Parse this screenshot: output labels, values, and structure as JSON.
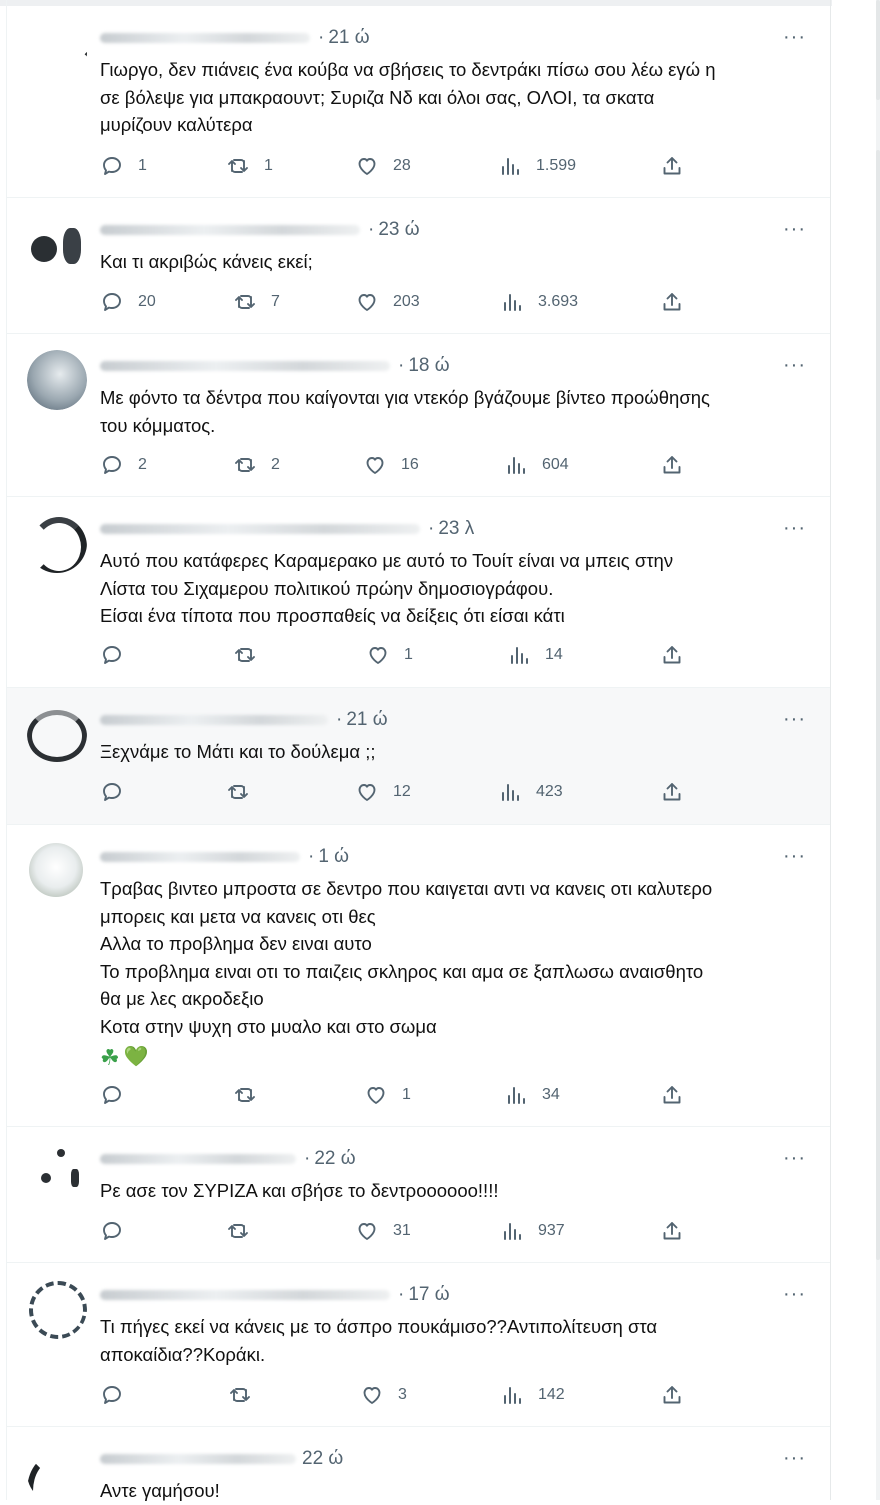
{
  "ui": {
    "more_label": "···"
  },
  "tweets": [
    {
      "time": "21 ώ",
      "text": [
        "Γιωργο, δεν πιάνεις ένα κούβα να σβήσεις το δεντράκι πίσω σου λέω εγώ η",
        "σε βόλεψε για μπακραουντ; Συριζα Νδ και όλοι σας, ΟΛΟΙ, τα σκατα",
        "μυρίζουν καλύτερα"
      ],
      "replies": "1",
      "reposts": "1",
      "likes": "28",
      "views": "1.599"
    },
    {
      "time": "23 ώ",
      "text": [
        "Και τι ακριβώς κάνεις εκεί;"
      ],
      "replies": "20",
      "reposts": "7",
      "likes": "203",
      "views": "3.693"
    },
    {
      "time": "18 ώ",
      "text": [
        "Με φόντο τα δέντρα που καίγονται για ντεκόρ βγάζουμε βίντεο προώθησης",
        "του κόμματος."
      ],
      "replies": "2",
      "reposts": "2",
      "likes": "16",
      "views": "604"
    },
    {
      "time": "23 λ",
      "text": [
        "Αυτό που κατάφερες Καραμερακο με αυτό το Τουίτ είναι να μπεις στην",
        "Λίστα του Σιχαμερου πολιτικού πρώην δημοσιογράφου.",
        "Είσαι ένα τίποτα που προσπαθείς να δείξεις ότι είσαι κάτι"
      ],
      "replies": "",
      "reposts": "",
      "likes": "1",
      "views": "14"
    },
    {
      "time": "21 ώ",
      "text": [
        "Ξεχνάμε το Μάτι και το δούλεμα ;;"
      ],
      "replies": "",
      "reposts": "",
      "likes": "12",
      "views": "423"
    },
    {
      "time": "1 ώ",
      "text": [
        "Τραβας βιντεο μπροστα σε δεντρο που καιγεται αντι να κανεις οτι καλυτερο",
        "μπορεις και μετα να κανεις οτι θες",
        "Αλλα το προβλημα δεν ειναι αυτο",
        "Το προβλημα ειναι οτι το παιζεις σκληρος και αμα σε ξαπλωσω αναισθητο",
        "θα με λες ακροδεξιο",
        "Κοτα στην ψυχη στο μυαλο και στο σωμα"
      ],
      "emoji": [
        "☘",
        "💚"
      ],
      "replies": "",
      "reposts": "",
      "likes": "1",
      "views": "34"
    },
    {
      "time": "22 ώ",
      "text": [
        "Ρε ασε τον ΣΥΡΙΖΑ και σβήσε το δεντροοοοοο!!!!"
      ],
      "replies": "",
      "reposts": "",
      "likes": "31",
      "views": "937"
    },
    {
      "time": "17 ώ",
      "text": [
        "Τι πήγες εκεί να κάνεις με το άσπρο πουκάμισο??Αντιπολίτευση στα",
        "αποκαίδια??Κοράκι."
      ],
      "replies": "",
      "reposts": "",
      "likes": "3",
      "views": "142"
    },
    {
      "time": "22 ώ",
      "text": [
        "Αντε γαμήσου!"
      ]
    }
  ]
}
